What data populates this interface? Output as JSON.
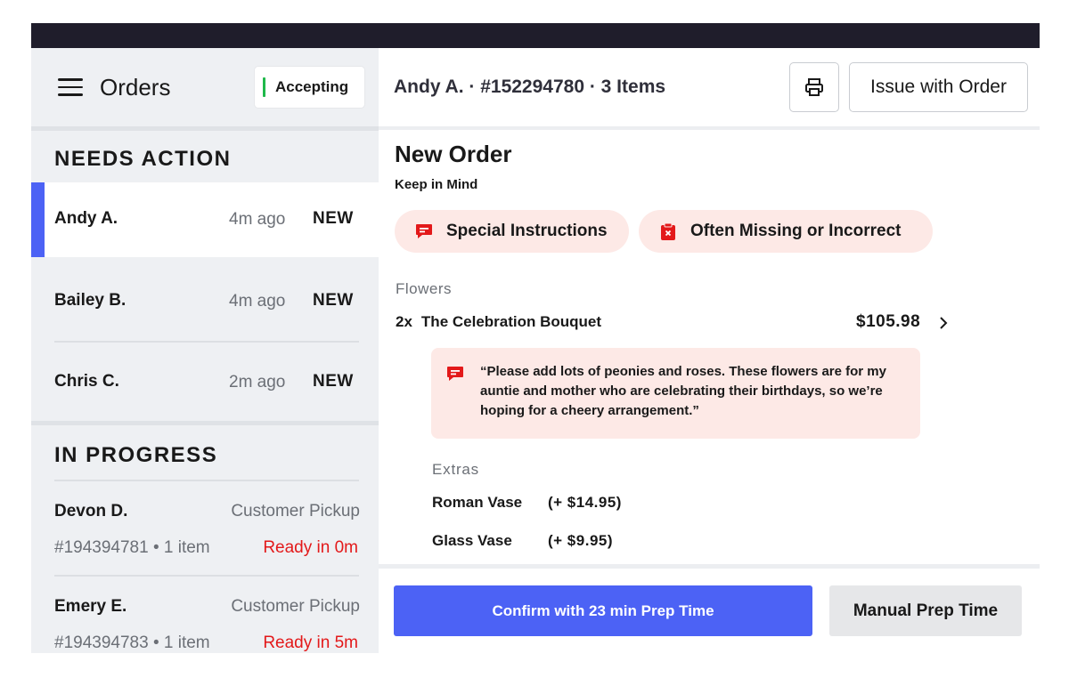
{
  "sidebar": {
    "title": "Orders",
    "status_label": "Accepting",
    "needs_action": {
      "title": "NEEDS ACTION",
      "orders": [
        {
          "name": "Andy A.",
          "time": "4m ago",
          "tag": "NEW"
        },
        {
          "name": "Bailey B.",
          "time": "4m ago",
          "tag": "NEW"
        },
        {
          "name": "Chris C.",
          "time": "2m ago",
          "tag": "NEW"
        }
      ]
    },
    "in_progress": {
      "title": "IN PROGRESS",
      "orders": [
        {
          "name": "Devon D.",
          "type": "Customer Pickup",
          "meta": "#194394781 • 1 item",
          "ready": "Ready in 0m"
        },
        {
          "name": "Emery E.",
          "type": "Customer Pickup",
          "meta": "#194394783 • 1 item",
          "ready": "Ready in 5m"
        }
      ]
    }
  },
  "header": {
    "title": "Andy A. · #152294780 · 3 Items",
    "print_icon": "printer-icon",
    "issue_label": "Issue with Order"
  },
  "order": {
    "heading": "New Order",
    "keep_in_mind": "Keep in Mind",
    "pills": [
      {
        "label": "Special Instructions",
        "icon": "chat-bubble-icon"
      },
      {
        "label": "Often Missing or Incorrect",
        "icon": "clipboard-alert-icon"
      }
    ],
    "category": "Flowers",
    "item": {
      "qty": "2x",
      "name": "The Celebration Bouquet",
      "price": "$105.98"
    },
    "note": "“Please add lots of peonies and roses. These flowers are for my auntie and mother who are celebrating their birthdays, so we’re hoping for a cheery arrangement.”",
    "extras_title": "Extras",
    "extras": [
      {
        "name": "Roman Vase",
        "price": "(+ $14.95)"
      },
      {
        "name": "Glass Vase",
        "price": "(+ $9.95)"
      }
    ]
  },
  "actions": {
    "confirm_label": "Confirm with 23 min Prep Time",
    "manual_label": "Manual Prep Time"
  },
  "colors": {
    "accent_blue": "#4c62f5",
    "alert_red": "#e3191a",
    "accepting_green": "#1fb84a",
    "alert_bg": "#fde9e6",
    "topbar": "#1f1d2b"
  }
}
